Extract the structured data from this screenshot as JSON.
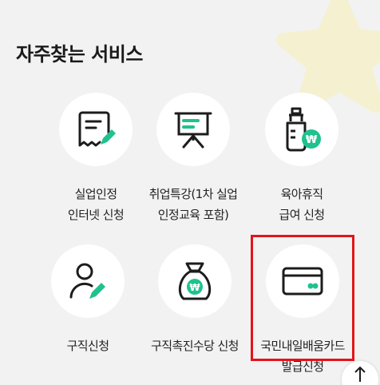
{
  "section": {
    "title": "자주찾는 서비스"
  },
  "services": [
    {
      "label_line1": "실업인정",
      "label_line2": "인터넷 신청",
      "icon": "document-pen-icon"
    },
    {
      "label_line1": "취업특강(1차 실업",
      "label_line2": "인정교육 포함)",
      "icon": "presentation-board-icon"
    },
    {
      "label_line1": "육아휴직",
      "label_line2": "급여 신청",
      "icon": "baby-bottle-won-icon"
    },
    {
      "label_line1": "구직신청",
      "label_line2": "",
      "icon": "person-pen-icon"
    },
    {
      "label_line1": "구직촉진수당 신청",
      "label_line2": "",
      "icon": "money-bag-won-icon"
    },
    {
      "label_line1": "국민내일배움카드",
      "label_line2": "발급신청",
      "icon": "card-icon"
    }
  ],
  "colors": {
    "accent_green": "#1fc28e",
    "highlight_red": "#e3141b",
    "background": "#f2f2f2",
    "star_yellow": "#f5f0cf"
  },
  "scroll_top": {
    "icon": "arrow-up-icon"
  }
}
